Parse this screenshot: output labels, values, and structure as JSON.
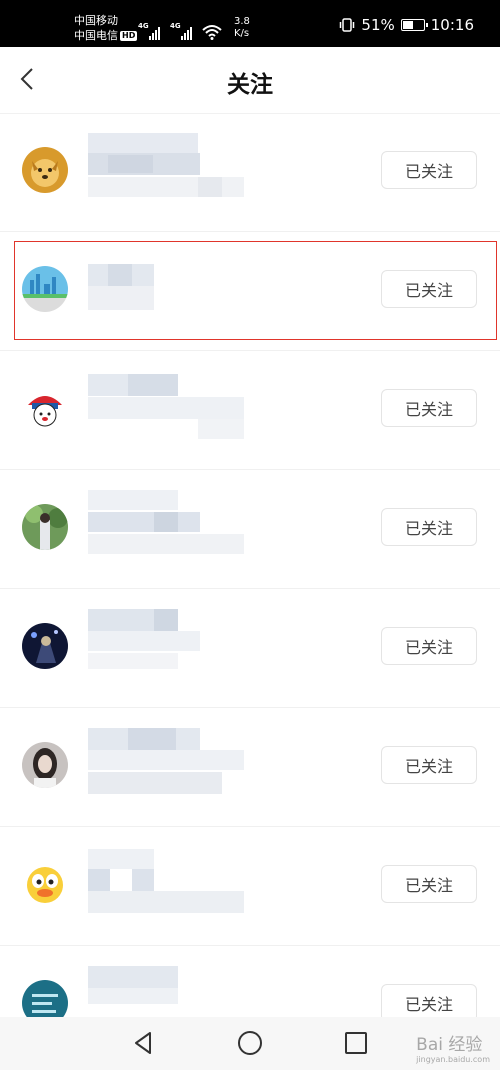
{
  "status_bar": {
    "carrier1": "中国移动",
    "carrier2": "中国电信",
    "hd_badge": "HD",
    "network1": "4G",
    "network2": "4G",
    "speed_value": "3.8",
    "speed_unit": "K/s",
    "battery_percent": "51%",
    "battery_level": 0.51,
    "time": "10:16"
  },
  "header": {
    "title": "关注"
  },
  "follow_list": {
    "items": [
      {
        "avatar": "dog-avatar",
        "button_label": "已关注"
      },
      {
        "avatar": "city-avatar",
        "button_label": "已关注"
      },
      {
        "avatar": "cartoon-avatar",
        "button_label": "已关注"
      },
      {
        "avatar": "person-garden-avatar",
        "button_label": "已关注"
      },
      {
        "avatar": "night-scene-avatar",
        "button_label": "已关注"
      },
      {
        "avatar": "portrait-avatar",
        "button_label": "已关注"
      },
      {
        "avatar": "duck-cartoon-avatar",
        "button_label": "已关注"
      },
      {
        "avatar": "teal-logo-avatar",
        "button_label": "已关注"
      }
    ]
  },
  "nav_bar": {
    "icons": [
      "back-triangle-icon",
      "home-circle-icon",
      "recents-square-icon"
    ]
  },
  "watermark": {
    "text": "Bai 经验",
    "subtext": "jingyan.baidu.com"
  },
  "colors": {
    "highlight": "#e0352b",
    "status_bar_bg": "#000000",
    "button_border": "#e4e4e4"
  }
}
